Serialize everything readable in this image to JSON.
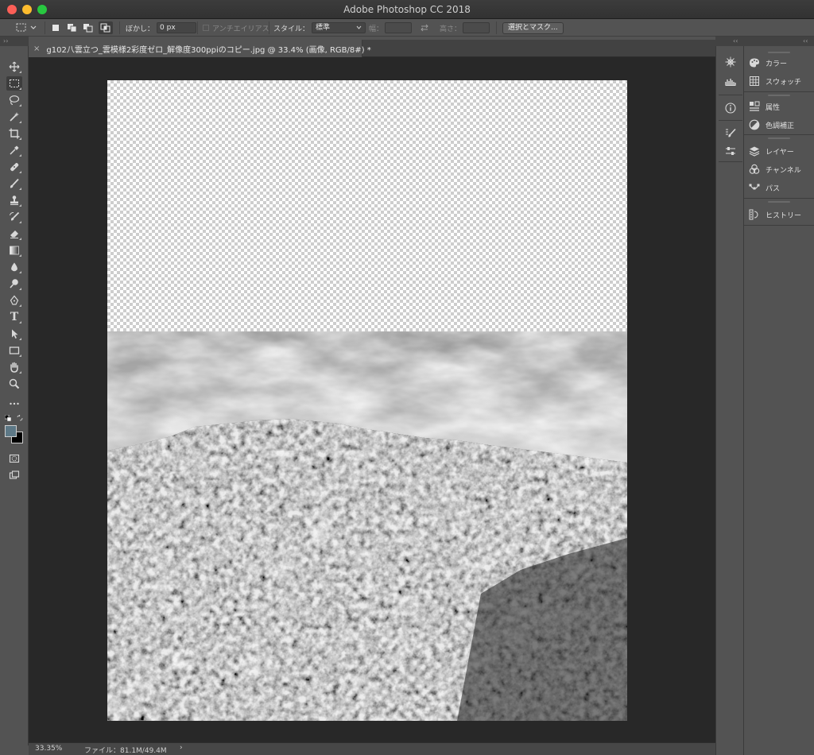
{
  "window": {
    "title": "Adobe Photoshop CC 2018"
  },
  "options_bar": {
    "feather_label": "ぼかし：",
    "feather_value": "0 px",
    "antialias_label": "アンチエイリアス",
    "style_label": "スタイル：",
    "style_value": "標準",
    "width_label": "幅：",
    "height_label": "高さ：",
    "select_mask_button": "選択とマスク..."
  },
  "document": {
    "tab_title": "g102八雲立つ_雲模様2彩度ゼロ_解像度300ppiのコピー.jpg @ 33.4% (画像, RGB/8#) *",
    "close_symbol": "×"
  },
  "status": {
    "zoom": "33.35%",
    "file_info": "ファイル：81.1M/49.4M",
    "arrow": "›"
  },
  "tools": [
    "move-tool",
    "marquee-tool",
    "lasso-tool",
    "magic-wand-tool",
    "crop-tool",
    "eyedropper-tool",
    "healing-brush-tool",
    "brush-tool",
    "clone-stamp-tool",
    "history-brush-tool",
    "eraser-tool",
    "gradient-tool",
    "blur-tool",
    "dodge-tool",
    "pen-tool",
    "type-tool",
    "path-selection-tool",
    "rectangle-tool",
    "hand-tool",
    "zoom-tool",
    "more-tools"
  ],
  "type_tool_glyph": "T",
  "colors": {
    "foreground": "#5d7886",
    "background": "#000000",
    "canvas_bg": "#282828",
    "ui_bg": "#535353"
  },
  "panels": {
    "color": "カラー",
    "swatches": "スウォッチ",
    "properties": "属性",
    "adjustments": "色調補正",
    "layers": "レイヤー",
    "channels": "チャンネル",
    "paths": "パス",
    "history": "ヒストリー"
  },
  "collapse_glyph": "‹‹",
  "expand_glyph": "››"
}
